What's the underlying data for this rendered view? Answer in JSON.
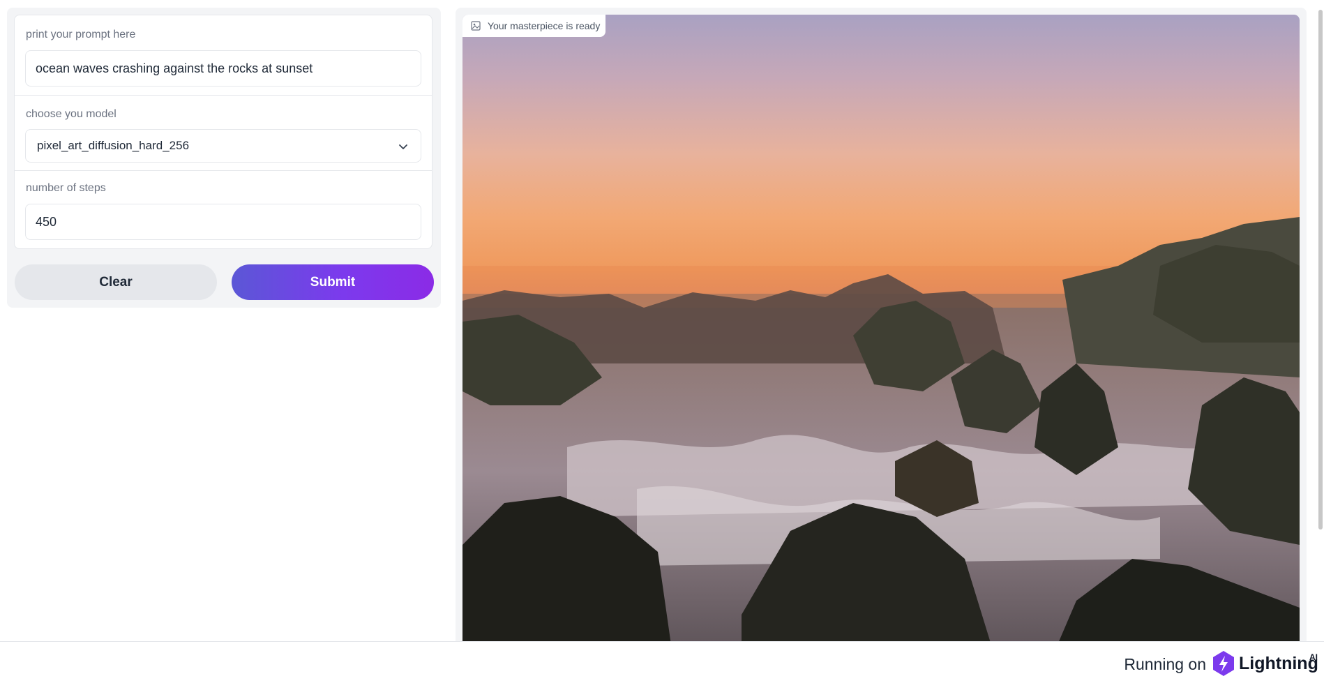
{
  "form": {
    "prompt": {
      "label": "print your prompt here",
      "value": "ocean waves crashing against the rocks at sunset"
    },
    "model": {
      "label": "choose you model",
      "selected": "pixel_art_diffusion_hard_256"
    },
    "steps": {
      "label": "number of steps",
      "value": "450"
    }
  },
  "buttons": {
    "clear": "Clear",
    "submit": "Submit"
  },
  "output": {
    "label": "Your masterpiece is ready",
    "image_description_icon": "image-icon"
  },
  "footer": {
    "prefix": "Running on",
    "brand": "Lightning",
    "brand_suffix": "AI"
  },
  "colors": {
    "accent_start": "#5b57d6",
    "accent_end": "#8b2be6",
    "brand_bolt": "#7c3aed"
  }
}
